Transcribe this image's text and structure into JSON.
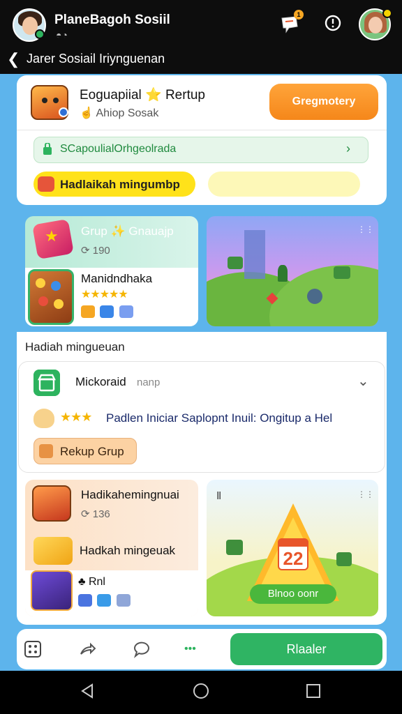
{
  "header": {
    "app_title": "PlaneBagoh Sosiil",
    "sub_glyph": "◓◔",
    "bell_badge": "1",
    "subtitle": "Jarer Sosiail Iriynguenan"
  },
  "card1": {
    "title": "Eoguapiial ⭐ Rertup",
    "subtitle": "☝ Ahiop Sosak",
    "button_label": "Gregmotery",
    "green_bar_text": "SCapoulialOrhgeolrada",
    "chip_label": "Hadlaikah mingumbp"
  },
  "grid1": {
    "left_title": "Grup ✨ Gnauajp",
    "left_count": "⟳ 190",
    "inner_title": "Manidndhaka",
    "stars": "★★★★★"
  },
  "section": {
    "label": "Hadiah mingueuan"
  },
  "card2": {
    "title": "Mickoraid",
    "tag": "nanp",
    "stars": "★★★",
    "text": "Padlen Iniciar Saplopnt Inuil: Ongitup a Hel",
    "button_label": "Rekup Grup"
  },
  "grid2": {
    "left_title": "Hadikahemingnuai",
    "left_count": "⟳ 136",
    "left_sub": "Hadkah mingeuak",
    "left_tag": "♣ Rnl",
    "right_num": "Ⅱ",
    "calendar_num": "22",
    "triangle_label": "Blnoo oonr"
  },
  "actionbar": {
    "dots": "•••",
    "button_label": "Rlaaler"
  },
  "colors": {
    "accent_orange": "#f5871a",
    "accent_green": "#2fb463",
    "accent_yellow": "#ffe21a",
    "background_blue": "#5db4ec"
  }
}
